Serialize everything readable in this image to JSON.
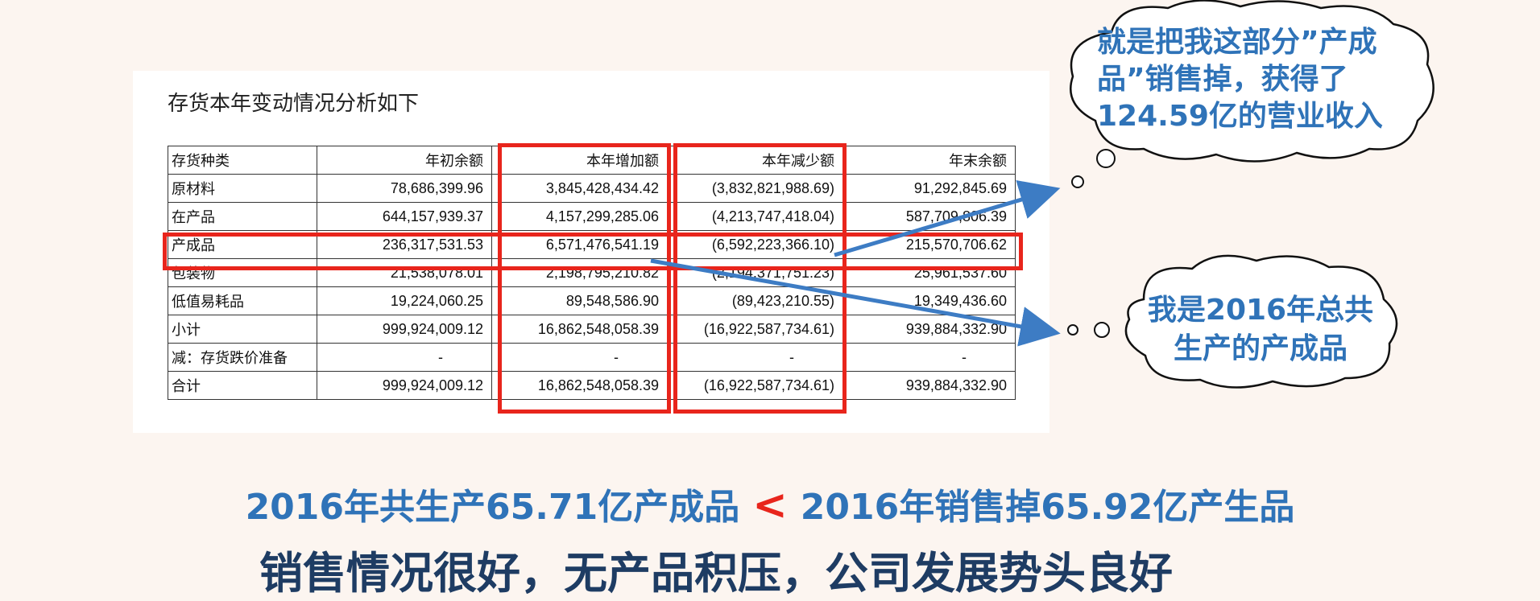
{
  "panel": {
    "title": "存货本年变动情况分析如下",
    "columns": [
      "存货种类",
      "年初余额",
      "本年增加额",
      "本年减少额",
      "年末余额"
    ],
    "rows": [
      [
        "原材料",
        "78,686,399.96",
        "3,845,428,434.42",
        "(3,832,821,988.69)",
        "91,292,845.69"
      ],
      [
        "在产品",
        "644,157,939.37",
        "4,157,299,285.06",
        "(4,213,747,418.04)",
        "587,709,806.39"
      ],
      [
        "产成品",
        "236,317,531.53",
        "6,571,476,541.19",
        "(6,592,223,366.10)",
        "215,570,706.62"
      ],
      [
        "包装物",
        "21,538,078.01",
        "2,198,795,210.82",
        "(2,194,371,751.23)",
        "25,961,537.60"
      ],
      [
        "低值易耗品",
        "19,224,060.25",
        "89,548,586.90",
        "(89,423,210.55)",
        "19,349,436.60"
      ],
      [
        "小计",
        "999,924,009.12",
        "16,862,548,058.39",
        "(16,922,587,734.61)",
        "939,884,332.90"
      ],
      [
        "减：存货跌价准备",
        "-",
        "-",
        "-",
        "-"
      ],
      [
        "合计",
        "999,924,009.12",
        "16,862,548,058.39",
        "(16,922,587,734.61)",
        "939,884,332.90"
      ]
    ]
  },
  "cloud_top": {
    "lines": [
      "就是把我这部分”产成",
      "品”销售掉，获得了",
      "124.59亿的营业收入"
    ]
  },
  "cloud_bottom": {
    "lines": [
      "我是2016年总共",
      "生产的产成品"
    ]
  },
  "caption": {
    "left": "2016年共生产65.71亿产成品",
    "symbol": "<",
    "right": "2016年销售掉65.92亿产生品",
    "conclusion": "销售情况很好，无产品积压，公司发展势头良好"
  },
  "colors": {
    "highlight_red": "#e8251c",
    "accent_blue": "#2f73b8",
    "dark_blue": "#1e3c63",
    "background": "#fcf5f0"
  }
}
